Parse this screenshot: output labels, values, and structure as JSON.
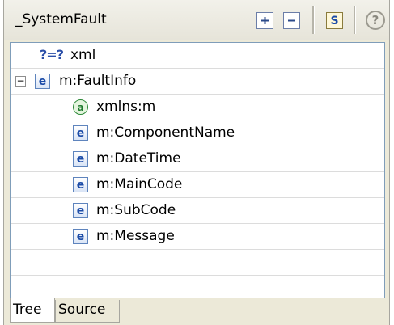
{
  "header": {
    "title": "_SystemFault",
    "expand_icon": "plus-square-icon",
    "collapse_icon": "minus-square-icon",
    "schema_icon": "s-document-icon",
    "help_icon": "question-circle-icon",
    "schema_glyph": "S",
    "help_glyph": "?"
  },
  "tree": {
    "rows": [
      {
        "icon": "?=?",
        "label": "xml"
      },
      {
        "icon": "e",
        "label": "m:FaultInfo",
        "expander": "−"
      },
      {
        "icon": "a",
        "label": "xmlns:m"
      },
      {
        "icon": "e",
        "label": "m:ComponentName"
      },
      {
        "icon": "e",
        "label": "m:DateTime"
      },
      {
        "icon": "e",
        "label": "m:MainCode"
      },
      {
        "icon": "e",
        "label": "m:SubCode"
      },
      {
        "icon": "e",
        "label": "m:Message"
      }
    ]
  },
  "tabs": [
    {
      "label": "Tree",
      "active": true
    },
    {
      "label": "Source",
      "active": false
    }
  ],
  "colors": {
    "panel_bg": "#ece9d8",
    "element_icon": "#1b4ba7",
    "attribute_icon": "#1f7a2e",
    "pi_icon": "#2a4ea8"
  }
}
